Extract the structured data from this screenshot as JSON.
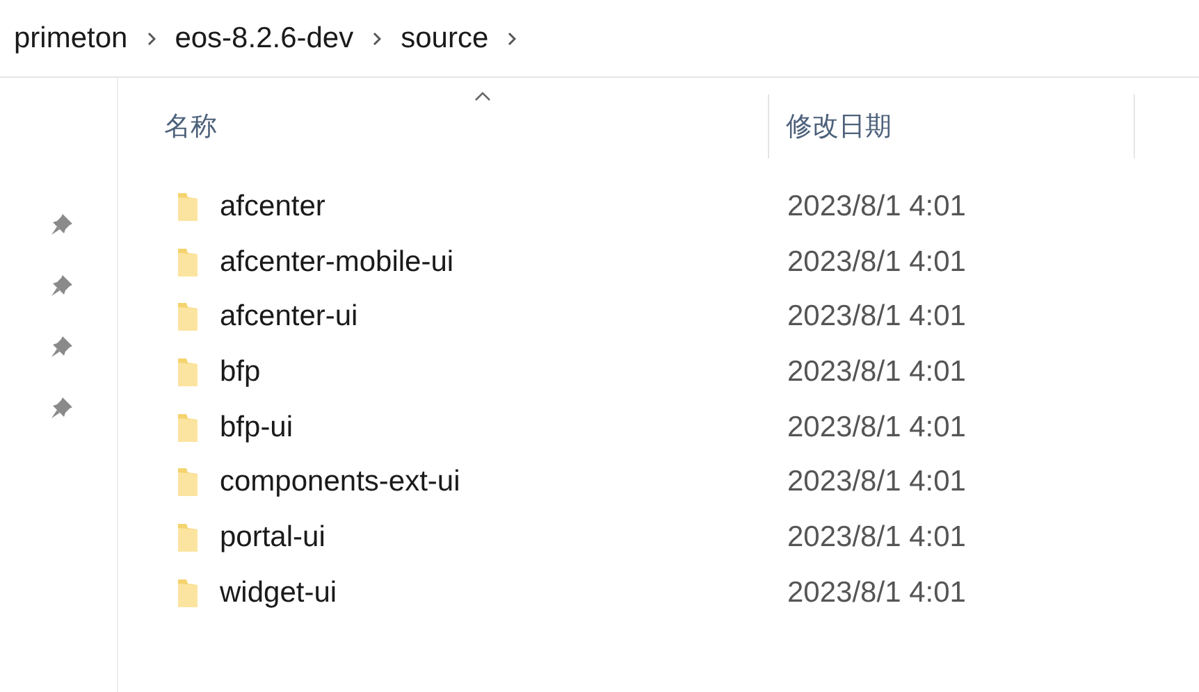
{
  "breadcrumb": [
    "primeton",
    "eos-8.2.6-dev",
    "source"
  ],
  "sidebar": {
    "items": [
      {
        "pinned": true
      },
      {
        "pinned": true
      },
      {
        "pinned": true
      },
      {
        "pinned": true
      }
    ]
  },
  "columns": [
    {
      "label": "名称",
      "sorted": true
    },
    {
      "label": "修改日期",
      "sorted": false
    }
  ],
  "rows": [
    {
      "name": "afcenter",
      "modified": "2023/8/1 4:01"
    },
    {
      "name": "afcenter-mobile-ui",
      "modified": "2023/8/1 4:01"
    },
    {
      "name": "afcenter-ui",
      "modified": "2023/8/1 4:01"
    },
    {
      "name": "bfp",
      "modified": "2023/8/1 4:01"
    },
    {
      "name": "bfp-ui",
      "modified": "2023/8/1 4:01"
    },
    {
      "name": "components-ext-ui",
      "modified": "2023/8/1 4:01"
    },
    {
      "name": "portal-ui",
      "modified": "2023/8/1 4:01"
    },
    {
      "name": "widget-ui",
      "modified": "2023/8/1 4:01"
    }
  ]
}
